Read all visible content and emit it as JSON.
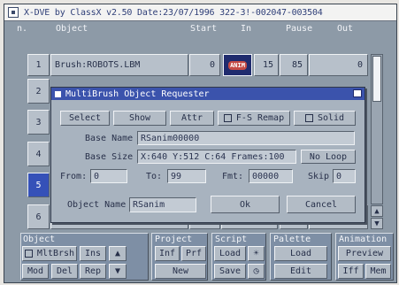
{
  "window": {
    "title": "X-DVE by ClassX v2.50 Date:23/07/1996 322-3!-002047-003504"
  },
  "columns": {
    "n": "n.",
    "object": "Object",
    "start": "Start",
    "in": "In",
    "pause": "Pause",
    "out": "Out"
  },
  "rows": [
    {
      "n": "1",
      "object": "Brush:ROBOTS.LBM",
      "start": "0",
      "icon": "ANIM",
      "in": "15",
      "pause": "85",
      "out": "0",
      "selected": false
    },
    {
      "n": "2",
      "selected": false
    },
    {
      "n": "3",
      "selected": false
    },
    {
      "n": "4",
      "selected": false
    },
    {
      "n": "5",
      "selected": true
    },
    {
      "n": "6",
      "selected": false
    }
  ],
  "requester": {
    "title": "MultiBrush Object Requester",
    "select": "Select",
    "show": "Show",
    "attr": "Attr",
    "fs_remap": "F-S Remap",
    "solid": "Solid",
    "base_name_label": "Base Name",
    "base_name_value": "RSanim00000",
    "base_size_label": "Base Size",
    "base_size_value": "X:640 Y:512 C:64 Frames:100",
    "loop_button": "No Loop",
    "from_label": "From:",
    "from_value": "0",
    "to_label": "To:",
    "to_value": "99",
    "fmt_label": "Fmt:",
    "fmt_value": "00000",
    "skip_label": "Skip",
    "skip_value": "0",
    "object_name_label": "Object Name",
    "object_name_value": "RSanim",
    "ok": "Ok",
    "cancel": "Cancel"
  },
  "bottom": {
    "object_title": "Object",
    "multibrush": "MltBrsh",
    "ins": "Ins",
    "mod": "Mod",
    "del": "Del",
    "rep": "Rep",
    "project_title": "Project",
    "inf": "Inf",
    "prf": "Prf",
    "new": "New",
    "script_title": "Script",
    "script_load": "Load",
    "script_save": "Save",
    "palette_title": "Palette",
    "palette_load": "Load",
    "palette_edit": "Edit",
    "animation_title": "Animation",
    "preview": "Preview",
    "iff": "Iff",
    "mem": "Mem"
  },
  "icons": {
    "close": "close-box-icon",
    "anim": "anim-thumbnail-icon",
    "up": "up-arrow-icon",
    "down": "down-arrow-icon",
    "sun": "sun-icon",
    "clock": "clock-icon"
  },
  "colors": {
    "screen_bg": "#8d9aa7",
    "title_blue": "#3b53ac",
    "selected_row": "#3551b8"
  }
}
